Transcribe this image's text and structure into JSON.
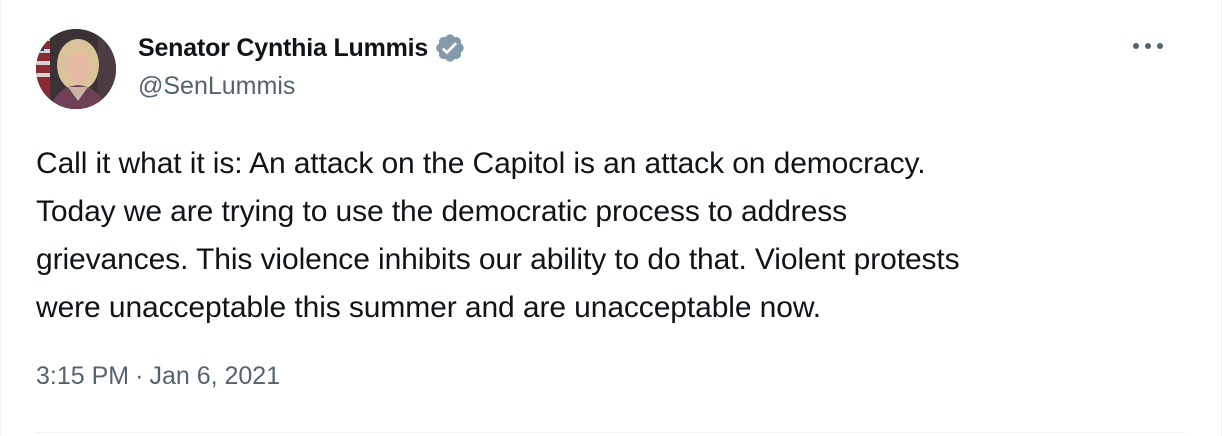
{
  "author": {
    "display_name": "Senator Cynthia Lummis",
    "handle": "@SenLummis",
    "verified_icon": "verified-badge-icon",
    "verified_color": "#829aab"
  },
  "more_icon": "more-options-icon",
  "tweet": {
    "lines": [
      "Call it what it is: An attack on the Capitol is an attack on democracy.",
      "Today we are trying to use the democratic process to address",
      "grievances. This violence inhibits our ability to do that. Violent protests",
      "were unacceptable this summer and are unacceptable now."
    ]
  },
  "meta": {
    "time": "3:15 PM",
    "separator": "·",
    "date": "Jan 6, 2021"
  },
  "colors": {
    "text_primary": "#0f1419",
    "text_secondary": "#536471",
    "border": "#eff3f4"
  }
}
